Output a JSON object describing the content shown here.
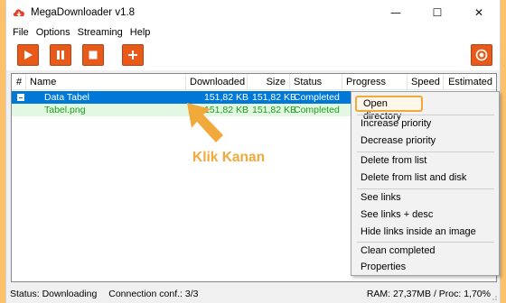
{
  "window": {
    "title": "MegaDownloader v1.8",
    "minimize_glyph": "—",
    "maximize_glyph": "☐",
    "close_glyph": "✕"
  },
  "menu": {
    "items": [
      "File",
      "Options",
      "Streaming",
      "Help"
    ]
  },
  "toolbar": {
    "play_icon": "play-icon",
    "pause_icon": "pause-icon",
    "stop_icon": "stop-icon",
    "add_icon": "plus-icon",
    "settings_icon": "gear-icon"
  },
  "list": {
    "columns": [
      "#",
      "Name",
      "Downloaded",
      "Size",
      "Status",
      "Progress",
      "Speed",
      "Estimated"
    ],
    "rows": [
      {
        "name": "Data Tabel",
        "downloaded": "151,82 KB",
        "size": "151,82 KB",
        "status": "Completed"
      },
      {
        "name": "Tabel.png",
        "downloaded": "151,82 KB",
        "size": "151,82 KB",
        "status": "Completed"
      }
    ]
  },
  "annotation": {
    "text": "Klik Kanan",
    "color": "#f2a93b"
  },
  "context_menu": {
    "items": [
      "Open directory",
      "Increase priority",
      "Decrease priority",
      "Delete from list",
      "Delete from list and disk",
      "See links",
      "See links + desc",
      "Hide links inside an image",
      "Clean completed",
      "Properties"
    ]
  },
  "status": {
    "left": "Status: Downloading",
    "connection": "Connection conf.: 3/3",
    "right": "RAM: 27,37MB / Proc: 1,70%"
  },
  "colors": {
    "accent": "#e85a1a",
    "selection": "#0078d7",
    "completed_text": "#1aa01a",
    "background": "#fbc26b"
  }
}
